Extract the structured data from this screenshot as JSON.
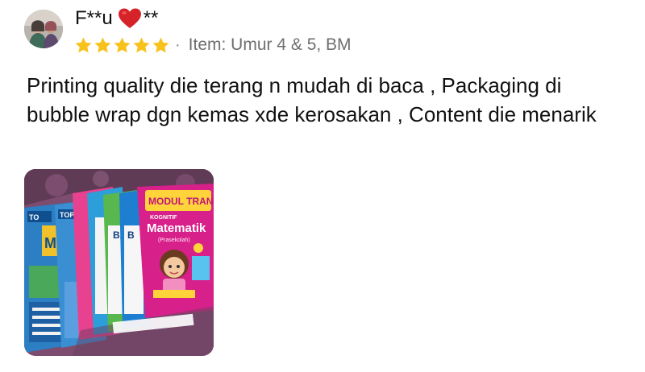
{
  "review": {
    "username_left": "F**u",
    "username_right": "**",
    "rating": 5,
    "rating_max": 5,
    "meta_separator": "·",
    "item_variant": "Item: Umur 4 & 5, BM",
    "text": "Printing quality die terang n mudah di baca , Packaging di bubble wrap dgn kemas xde kerosakan , Content die menarik",
    "colors": {
      "star": "#f7c21c",
      "heart": "#d6232a",
      "meta_text": "#6f6f6f"
    },
    "photo": {
      "description_icon": "product-photo",
      "book_titles": {
        "front_title": "Matematik",
        "front_subtitle": "(Prasekolah)",
        "front_header": "MODUL TRANSISI",
        "front_badge": "KOGNITIF",
        "spine_labels": [
          "BA",
          "B"
        ],
        "left_labels": [
          "TO",
          "TOP",
          "M"
        ]
      }
    }
  }
}
